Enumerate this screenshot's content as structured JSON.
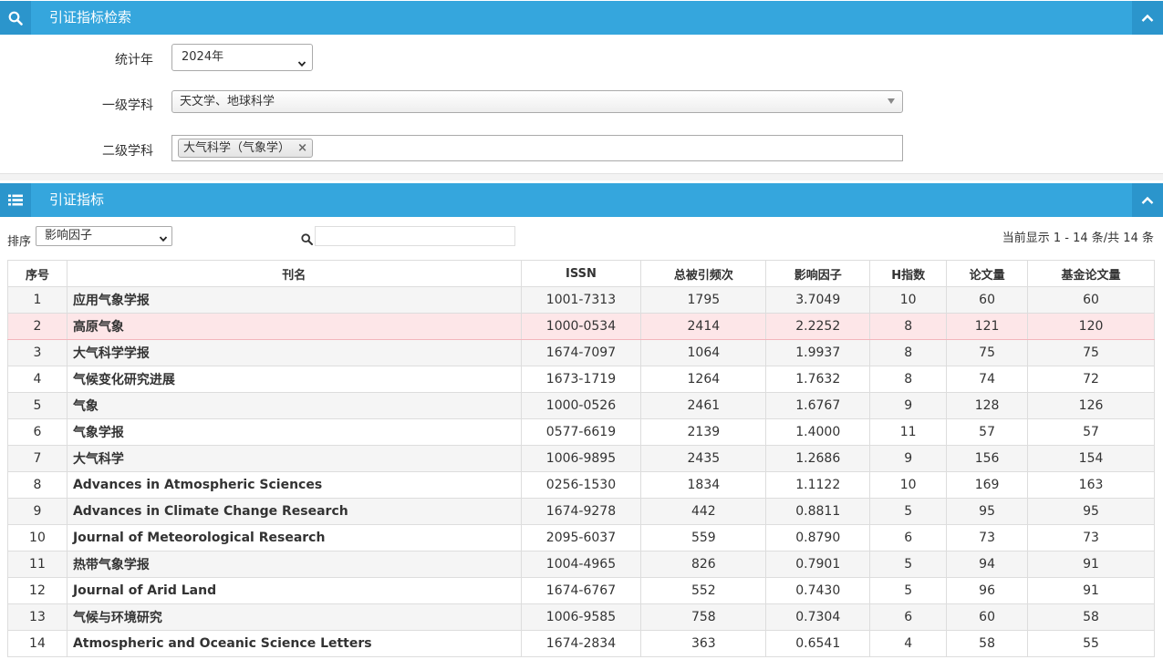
{
  "search_panel": {
    "title": "引证指标检索"
  },
  "form": {
    "year_label": "统计年",
    "year_value": "2024年",
    "level1_label": "一级学科",
    "level1_value": "天文学、地球科学",
    "level2_label": "二级学科",
    "level2_chip": "大气科学（气象学）",
    "chip_remove": "×"
  },
  "results_panel": {
    "title": "引证指标"
  },
  "toolbar": {
    "sort_label": "排序",
    "sort_value": "影响因子",
    "search_value": "",
    "page_info": "当前显示 1 - 14 条/共 14 条"
  },
  "table": {
    "headers": [
      "序号",
      "刊名",
      "ISSN",
      "总被引频次",
      "影响因子",
      "H指数",
      "论文量",
      "基金论文量"
    ],
    "rows": [
      [
        "1",
        "应用气象学报",
        "1001-7313",
        "1795",
        "3.7049",
        "10",
        "60",
        "60"
      ],
      [
        "2",
        "高原气象",
        "1000-0534",
        "2414",
        "2.2252",
        "8",
        "121",
        "120"
      ],
      [
        "3",
        "大气科学学报",
        "1674-7097",
        "1064",
        "1.9937",
        "8",
        "75",
        "75"
      ],
      [
        "4",
        "气候变化研究进展",
        "1673-1719",
        "1264",
        "1.7632",
        "8",
        "74",
        "72"
      ],
      [
        "5",
        "气象",
        "1000-0526",
        "2461",
        "1.6767",
        "9",
        "128",
        "126"
      ],
      [
        "6",
        "气象学报",
        "0577-6619",
        "2139",
        "1.4000",
        "11",
        "57",
        "57"
      ],
      [
        "7",
        "大气科学",
        "1006-9895",
        "2435",
        "1.2686",
        "9",
        "156",
        "154"
      ],
      [
        "8",
        "Advances in Atmospheric Sciences",
        "0256-1530",
        "1834",
        "1.1122",
        "10",
        "169",
        "163"
      ],
      [
        "9",
        "Advances in Climate Change Research",
        "1674-9278",
        "442",
        "0.8811",
        "5",
        "95",
        "95"
      ],
      [
        "10",
        "Journal of Meteorological Research",
        "2095-6037",
        "559",
        "0.8790",
        "6",
        "73",
        "73"
      ],
      [
        "11",
        "热带气象学报",
        "1004-4965",
        "826",
        "0.7901",
        "5",
        "94",
        "91"
      ],
      [
        "12",
        "Journal of Arid Land",
        "1674-6767",
        "552",
        "0.7430",
        "5",
        "96",
        "91"
      ],
      [
        "13",
        "气候与环境研究",
        "1006-9585",
        "758",
        "0.7304",
        "6",
        "60",
        "58"
      ],
      [
        "14",
        "Atmospheric and Oceanic Science Letters",
        "1674-2834",
        "363",
        "0.6541",
        "4",
        "58",
        "55"
      ]
    ],
    "highlight_row": 1
  },
  "colors": {
    "header_bar": "#35a6dd",
    "icon_box": "#2b95cc",
    "highlight_row": "#fde6e8"
  },
  "icons": {
    "search_panel": "search-icon",
    "results_panel": "list-icon",
    "collapse": "chevron-up-icon"
  }
}
